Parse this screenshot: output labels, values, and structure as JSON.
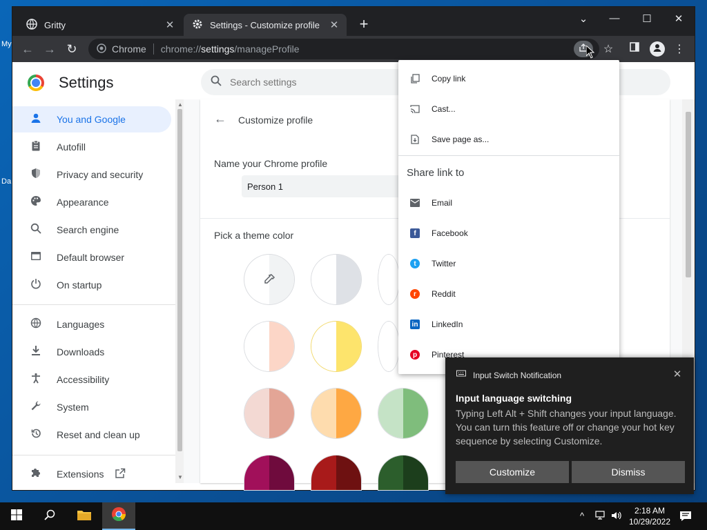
{
  "desktop": {
    "label_top": "My",
    "label_bottom": "Da"
  },
  "browser": {
    "tabs": [
      {
        "title": "Gritty",
        "close": "✕"
      },
      {
        "title": "Settings - Customize profile",
        "close": "✕"
      }
    ],
    "new_tab": "+",
    "window_controls": {
      "tab_search": "⌄",
      "minimize": "—",
      "maximize": "☐",
      "close": "✕"
    },
    "omnibox": {
      "origin_label": "Chrome",
      "scheme": "chrome://",
      "host": "settings",
      "path": "/manageProfile"
    }
  },
  "settings": {
    "title": "Settings",
    "search_placeholder": "Search settings",
    "sidebar": [
      {
        "label": "You and Google",
        "icon": "person-icon"
      },
      {
        "label": "Autofill",
        "icon": "clipboard-icon"
      },
      {
        "label": "Privacy and security",
        "icon": "shield-icon"
      },
      {
        "label": "Appearance",
        "icon": "palette-icon"
      },
      {
        "label": "Search engine",
        "icon": "search-icon"
      },
      {
        "label": "Default browser",
        "icon": "browser-icon"
      },
      {
        "label": "On startup",
        "icon": "power-icon"
      },
      {
        "label": "Languages",
        "icon": "globe-icon"
      },
      {
        "label": "Downloads",
        "icon": "download-icon"
      },
      {
        "label": "Accessibility",
        "icon": "accessibility-icon"
      },
      {
        "label": "System",
        "icon": "wrench-icon"
      },
      {
        "label": "Reset and clean up",
        "icon": "history-icon"
      },
      {
        "label": "Extensions",
        "icon": "puzzle-icon"
      }
    ],
    "page_title": "Customize profile",
    "name_label": "Name your Chrome profile",
    "profile_name": "Person 1",
    "theme_label": "Pick a theme color"
  },
  "share_menu": {
    "items": [
      {
        "label": "Copy link",
        "icon": "copy-icon"
      },
      {
        "label": "Cast...",
        "icon": "cast-icon"
      },
      {
        "label": "Save page as...",
        "icon": "save-icon"
      }
    ],
    "share_heading": "Share link to",
    "targets": [
      {
        "label": "Email",
        "icon": "email-icon",
        "color": "#5f6368"
      },
      {
        "label": "Facebook",
        "icon": "facebook-icon",
        "color": "#3b5998"
      },
      {
        "label": "Twitter",
        "icon": "twitter-icon",
        "color": "#1da1f2"
      },
      {
        "label": "Reddit",
        "icon": "reddit-icon",
        "color": "#ff4500"
      },
      {
        "label": "LinkedIn",
        "icon": "linkedin-icon",
        "color": "#0a66c2"
      },
      {
        "label": "Pinterest",
        "icon": "pinterest-icon",
        "color": "#e60023"
      }
    ]
  },
  "notification": {
    "app": "Input Switch Notification",
    "title": "Input language switching",
    "body": "Typing Left Alt + Shift changes your input language. You can turn this feature off or change your hot key sequence by selecting Customize.",
    "customize_label": "Customize",
    "dismiss_label": "Dismiss"
  },
  "taskbar": {
    "time": "2:18 AM",
    "date": "10/29/2022"
  },
  "colors": {
    "accent": "#1a73e8",
    "dark_frame": "#202124",
    "toolbar": "#35363a"
  }
}
